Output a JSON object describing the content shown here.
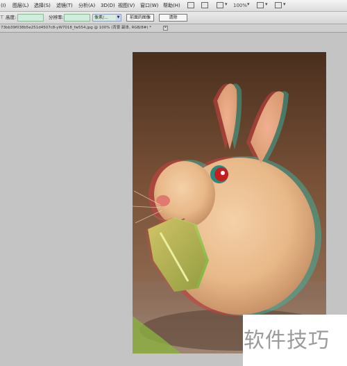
{
  "menu": {
    "items": [
      "(I)",
      "图层(L)",
      "选择(S)",
      "滤镜(T)",
      "分析(A)",
      "3D(D)",
      "视图(V)",
      "窗口(W)",
      "帮助(H)"
    ],
    "zoom": "100%"
  },
  "options": {
    "tool_marker": "⊤",
    "height_label": "高度:",
    "resolution_label": "分辨率:",
    "unit_select": "像素/...",
    "front_image_button": "前面的图像",
    "clear_button": "清除"
  },
  "document": {
    "tab_title": "73bb39f038b5e251d4507c8-yW7018_fw554.jpg @ 100% (背景 副本, RGB/8#) *",
    "close_glyph": "✕"
  },
  "watermark": {
    "text": "软件技巧"
  }
}
